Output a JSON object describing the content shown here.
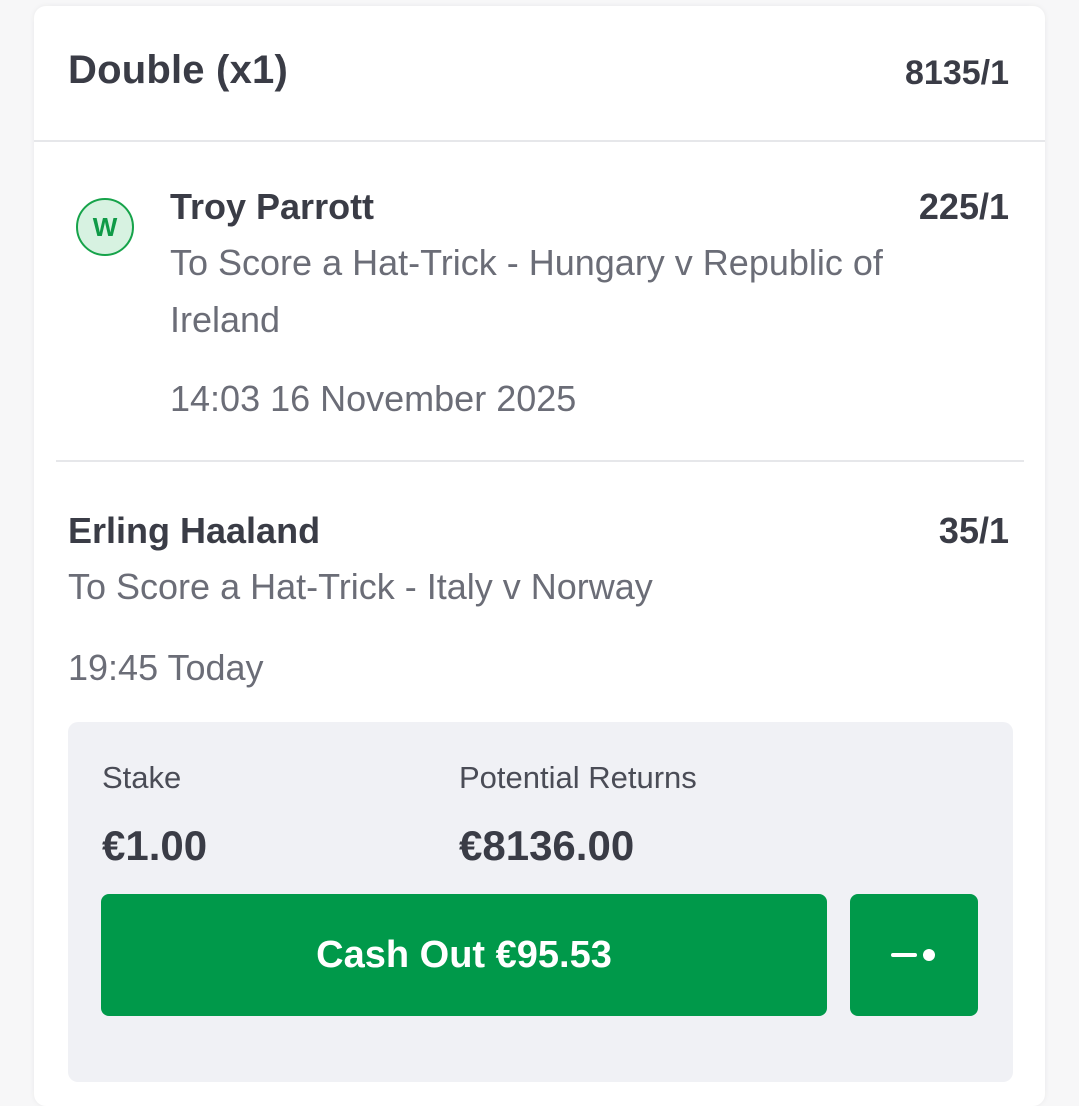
{
  "bet": {
    "title": "Double (x1)",
    "odds": "8135/1"
  },
  "selections": [
    {
      "status_badge": "W",
      "name": "Troy Parrott",
      "odds": "225/1",
      "market": "To Score a Hat-Trick - Hungary v Republic of Ireland",
      "time": "14:03 16 November 2025"
    },
    {
      "name": "Erling Haaland",
      "odds": "35/1",
      "market": "To Score a Hat-Trick - Italy v Norway",
      "time": "19:45 Today"
    }
  ],
  "summary": {
    "stake_label": "Stake",
    "stake_value": "€1.00",
    "returns_label": "Potential Returns",
    "returns_value": "€8136.00"
  },
  "actions": {
    "cash_out_label": "Cash Out €95.53",
    "partial_cash_out_icon": "slider-toggle-icon"
  },
  "colors": {
    "accent_green": "#00994a",
    "win_badge_bg": "#d7f2e1",
    "win_badge_border": "#16a34a"
  }
}
